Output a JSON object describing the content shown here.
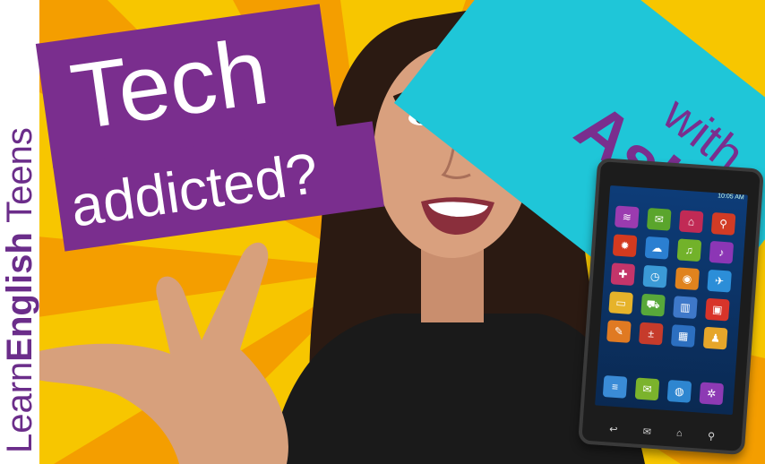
{
  "brand": {
    "part1": "Learn",
    "part2": "English",
    "part3": " Teens"
  },
  "title": {
    "line1": "Tech",
    "line2": "addicted?"
  },
  "corner": {
    "with": "with",
    "name": "Asha"
  },
  "colors": {
    "purple": "#7a2e8e",
    "cyan": "#1fc6d8",
    "yellow": "#f7c600",
    "orange": "#f49e00"
  },
  "tablet": {
    "time": "10:05 AM",
    "apps": [
      {
        "icon": "wifi-icon",
        "glyph": "≋",
        "color": "#9b3bb0"
      },
      {
        "icon": "chat-icon",
        "glyph": "✉",
        "color": "#5aa52c"
      },
      {
        "icon": "home-icon",
        "glyph": "⌂",
        "color": "#c12a55"
      },
      {
        "icon": "search-icon",
        "glyph": "⚲",
        "color": "#d23b25"
      },
      {
        "icon": "settings-icon",
        "glyph": "✹",
        "color": "#d33a1f"
      },
      {
        "icon": "cloud-icon",
        "glyph": "☁",
        "color": "#2b7fd1"
      },
      {
        "icon": "headphones-icon",
        "glyph": "♫",
        "color": "#72b22a"
      },
      {
        "icon": "mic-icon",
        "glyph": "♪",
        "color": "#8c36b5"
      },
      {
        "icon": "gamepad-icon",
        "glyph": "✚",
        "color": "#c4356a"
      },
      {
        "icon": "clock-icon",
        "glyph": "◷",
        "color": "#3b9ad6"
      },
      {
        "icon": "camera-icon",
        "glyph": "◉",
        "color": "#e0831e"
      },
      {
        "icon": "plane-icon",
        "glyph": "✈",
        "color": "#2c8ed8"
      },
      {
        "icon": "folder-icon",
        "glyph": "▭",
        "color": "#e6b32a"
      },
      {
        "icon": "cart-icon",
        "glyph": "⛟",
        "color": "#58a83a"
      },
      {
        "icon": "chart-icon",
        "glyph": "▥",
        "color": "#3e78c9"
      },
      {
        "icon": "film-icon",
        "glyph": "▣",
        "color": "#d8342a"
      },
      {
        "icon": "pin-icon",
        "glyph": "✎",
        "color": "#e07a22"
      },
      {
        "icon": "calculator-icon",
        "glyph": "±",
        "color": "#c63b2b"
      },
      {
        "icon": "video-icon",
        "glyph": "▦",
        "color": "#2c6fc0"
      },
      {
        "icon": "user-icon",
        "glyph": "♟",
        "color": "#e6a62a"
      }
    ],
    "dock": [
      {
        "icon": "document-icon",
        "glyph": "≡",
        "color": "#3a8bd6"
      },
      {
        "icon": "mail-icon",
        "glyph": "✉",
        "color": "#7bb32c"
      },
      {
        "icon": "globe-icon",
        "glyph": "◍",
        "color": "#2e86d0"
      },
      {
        "icon": "gear-icon",
        "glyph": "✲",
        "color": "#8d3ab4"
      }
    ]
  }
}
